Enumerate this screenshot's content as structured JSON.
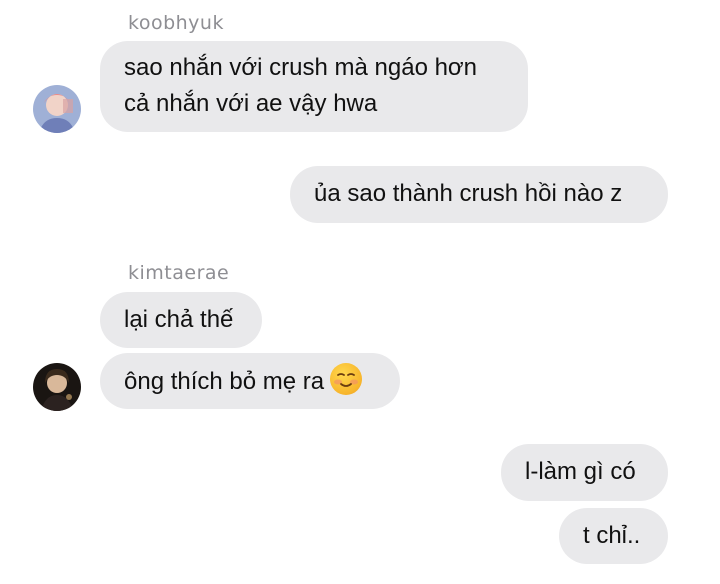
{
  "conversation": {
    "groups": [
      {
        "sender": "koobhyuk",
        "messages": [
          "sao nhắn với crush mà ngáo hơn",
          "cả nhắn với ae vậy hwa"
        ]
      },
      {
        "sent": [
          "ủa sao thành crush hồi nào z"
        ]
      },
      {
        "sender": "kimtaerae",
        "messages": [
          "lại chả thế",
          "ông thích bỏ mẹ ra"
        ]
      },
      {
        "sent": [
          "l-làm gì có",
          "t chỉ.."
        ]
      }
    ]
  },
  "icons": {
    "emoji": "smiling-face-with-blush-emoji",
    "avatar_1": "koobhyuk-avatar",
    "avatar_2": "kimtaerae-avatar"
  },
  "colors": {
    "bubble": "#e9e9eb",
    "sender_text": "#8e8e93",
    "background": "#ffffff"
  }
}
